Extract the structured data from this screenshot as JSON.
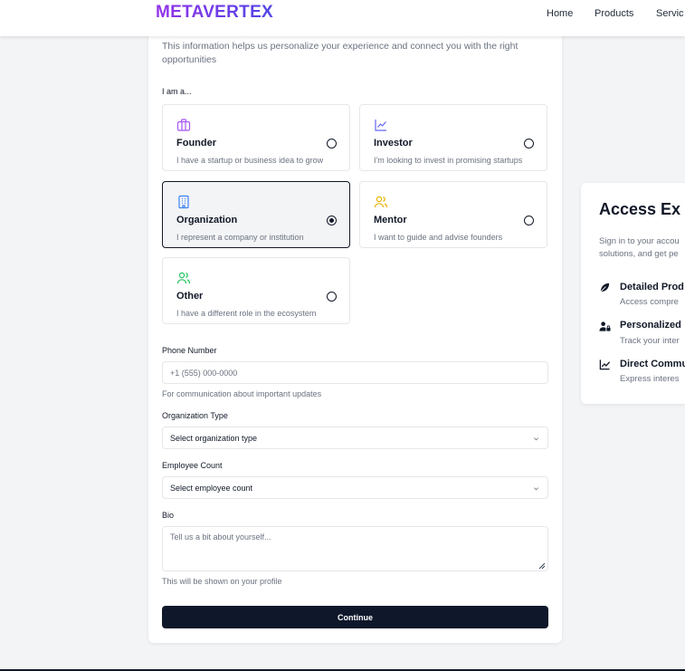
{
  "nav": {
    "logo": "METAVERTEX",
    "links": [
      "Home",
      "Products",
      "Servic"
    ]
  },
  "form": {
    "intro_line1": "This information helps us personalize your experience and connect you with the right",
    "intro_line2": "opportunities",
    "role_prompt": "I am a...",
    "roles": [
      {
        "title": "Founder",
        "description": "I have a startup or business idea to grow",
        "icon": "briefcase-icon",
        "color": "#a855f7",
        "selected": false
      },
      {
        "title": "Investor",
        "description": "I'm looking to invest in promising startups",
        "icon": "chart-line-icon",
        "color": "#6366f1",
        "selected": false
      },
      {
        "title": "Organization",
        "description": "I represent a company or institution",
        "icon": "building-icon",
        "color": "#3b82f6",
        "selected": true
      },
      {
        "title": "Mentor",
        "description": "I want to guide and advise founders",
        "icon": "users-icon",
        "color": "#eab308",
        "selected": false
      },
      {
        "title": "Other",
        "description": "I have a different role in the ecosystem",
        "icon": "users-icon",
        "color": "#22c55e",
        "selected": false
      }
    ],
    "phone": {
      "label": "Phone Number",
      "placeholder": "+1 (555) 000-0000",
      "hint": "For communication about important updates"
    },
    "org_type": {
      "label": "Organization Type",
      "value": "Select organization type"
    },
    "employee_count": {
      "label": "Employee Count",
      "value": "Select employee count"
    },
    "bio": {
      "label": "Bio",
      "placeholder": "Tell us a bit about yourself...",
      "hint": "This will be shown on your profile"
    },
    "continue_label": "Continue"
  },
  "side_panel": {
    "title": "Access Ex",
    "text_line1": "Sign in to your accou",
    "text_line2": "solutions, and get pe",
    "features": [
      {
        "title": "Detailed Prod",
        "description": "Access compre",
        "icon": "leaf-icon"
      },
      {
        "title": "Personalized",
        "description": "Track your inter",
        "icon": "user-lock-icon"
      },
      {
        "title": "Direct Commu",
        "description": "Express interes",
        "icon": "trend-chart-icon"
      }
    ]
  },
  "colors": {
    "primary_button": "#0f172a",
    "logo_gradient_start": "#9333ea",
    "logo_gradient_end": "#4f46e5"
  }
}
